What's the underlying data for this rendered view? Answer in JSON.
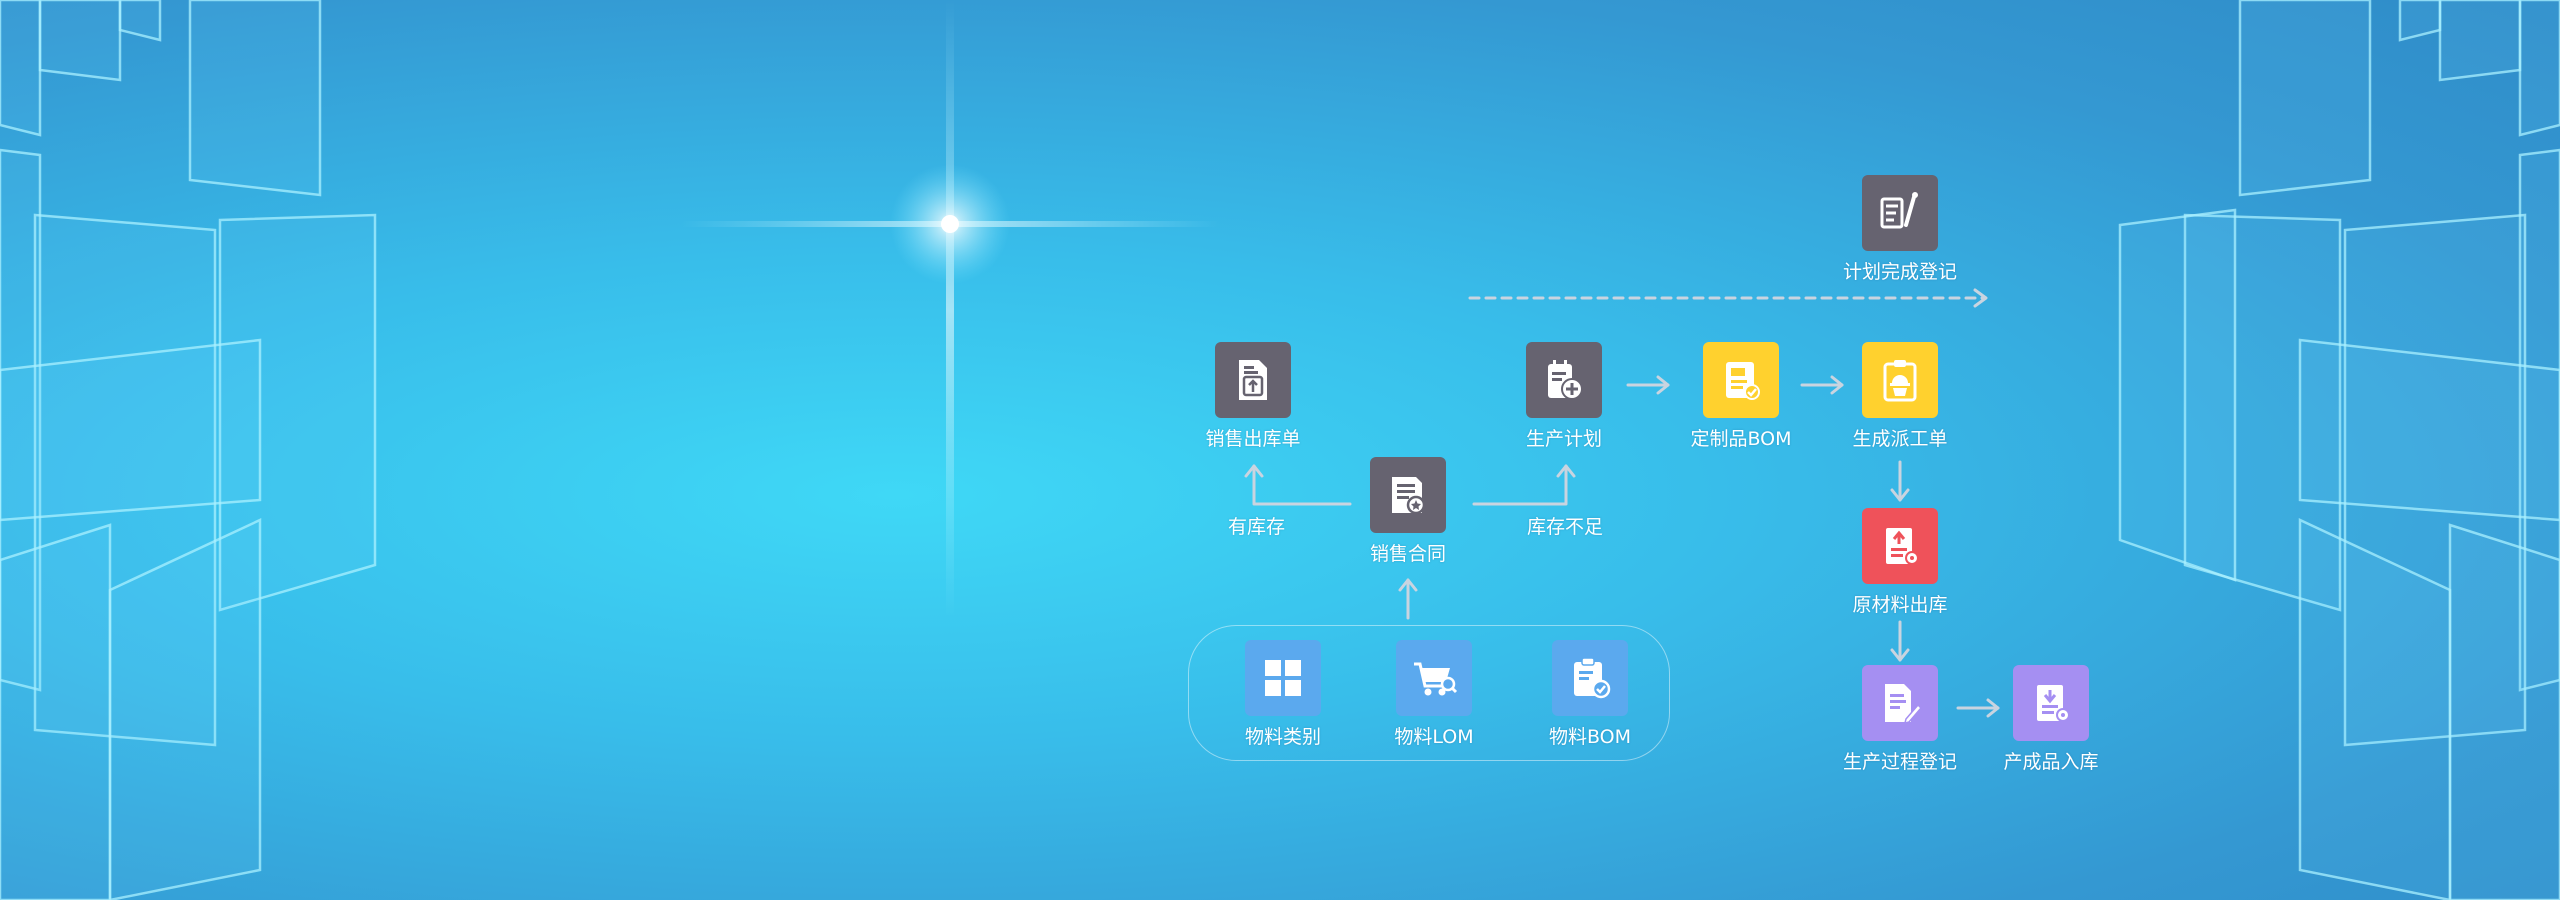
{
  "nodes": {
    "plan_complete": "计划完成登记",
    "sales_out": "销售出库单",
    "production_plan": "生产计划",
    "custom_bom": "定制品BOM",
    "dispatch": "生成派工单",
    "sales_contract": "销售合同",
    "raw_out": "原材料出库",
    "process_record": "生产过程登记",
    "product_in": "产成品入库",
    "material_category": "物料类别",
    "material_lom": "物料LOM",
    "material_bom": "物料BOM"
  },
  "branches": {
    "in_stock": "有库存",
    "out_of_stock": "库存不足"
  },
  "icons": {
    "plan_complete": "edit-document-icon",
    "sales_out": "export-document-icon",
    "production_plan": "add-plan-icon",
    "custom_bom": "checked-document-icon",
    "dispatch": "worker-clipboard-icon",
    "sales_contract": "contract-stamp-icon",
    "raw_out": "upload-document-icon",
    "process_record": "write-document-icon",
    "product_in": "import-document-icon",
    "material_category": "grid-icon",
    "material_lom": "cart-icon",
    "material_bom": "clipboard-check-icon"
  },
  "colors": {
    "gray": "#666370",
    "yellow": "#ffd12e",
    "red": "#ef525a",
    "purple": "#a58ff2",
    "blue": "#5ba9ee"
  }
}
